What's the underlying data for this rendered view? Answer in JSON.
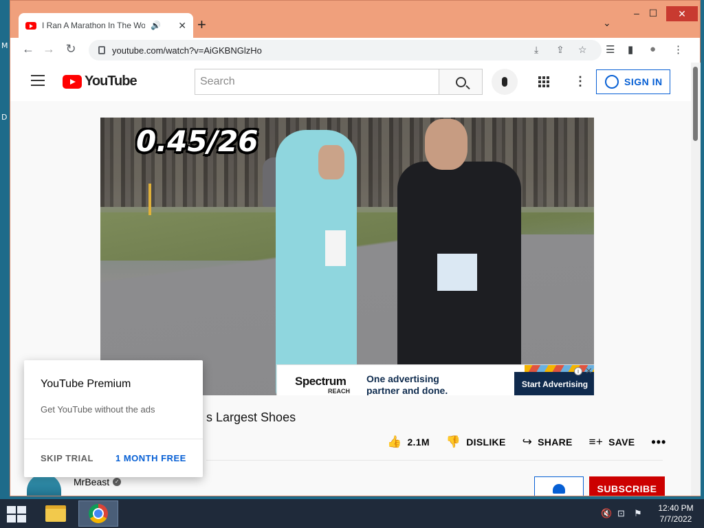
{
  "desktop": {
    "edge_glyph_1": "M",
    "edge_glyph_2": "D"
  },
  "browser": {
    "tab": {
      "title": "I Ran A Marathon In The World's Largest Shoes",
      "audio_icon": "speaker-icon",
      "close": "✕"
    },
    "new_tab": "+",
    "tab_dropdown": "⌄",
    "window_controls": {
      "minimize": "–",
      "maximize": "☐",
      "close": "✕"
    },
    "nav": {
      "back": "←",
      "forward": "→",
      "reload": "↻"
    },
    "url": "youtube.com/watch?v=AiGKBNGlzHo",
    "omnibox_icons": {
      "install": "⤓",
      "share": "⇪",
      "bookmark": "☆"
    },
    "toolbar_icons": {
      "reading_list": "☰",
      "side_panel": "▮",
      "profile": "●",
      "menu": "⋮"
    }
  },
  "youtube": {
    "logo_text": "YouTube",
    "search_placeholder": "Search",
    "more_icon": "⋮",
    "sign_in": "SIGN IN",
    "video": {
      "overlay_counter": "0.45/26",
      "ad": {
        "brand": "Spectrum",
        "brand_sub": "REACH",
        "line1": "One advertising",
        "line2": "partner and done.",
        "cta": "Start Advertising",
        "info": "i",
        "close": "✕"
      }
    },
    "title_visible": "s Largest Shoes",
    "actions": {
      "like_icon": "👍",
      "likes": "2.1M",
      "dislike_icon": "👎",
      "dislike": "DISLIKE",
      "share_icon": "↪",
      "share": "SHARE",
      "save_icon": "≡+",
      "save": "SAVE",
      "more": "•••"
    },
    "channel": {
      "name": "MrBeast",
      "verified": "✓"
    },
    "subscribe": "SUBSCRIBE"
  },
  "premium_popup": {
    "title": "YouTube Premium",
    "subtitle": "Get YouTube without the ads",
    "skip": "SKIP TRIAL",
    "offer": "1 MONTH FREE"
  },
  "taskbar": {
    "tray": {
      "volume_muted": "🔇",
      "network": "⊡",
      "flag": "⚑"
    },
    "time": "12:40 PM",
    "date": "7/7/2022"
  },
  "colors": {
    "window_frame": "#f0a07c",
    "youtube_red": "#ff0000",
    "link_blue": "#065fd4",
    "subscribe_red": "#cc0000",
    "ad_navy": "#0f2a4d",
    "taskbar": "#1f2a3a"
  }
}
